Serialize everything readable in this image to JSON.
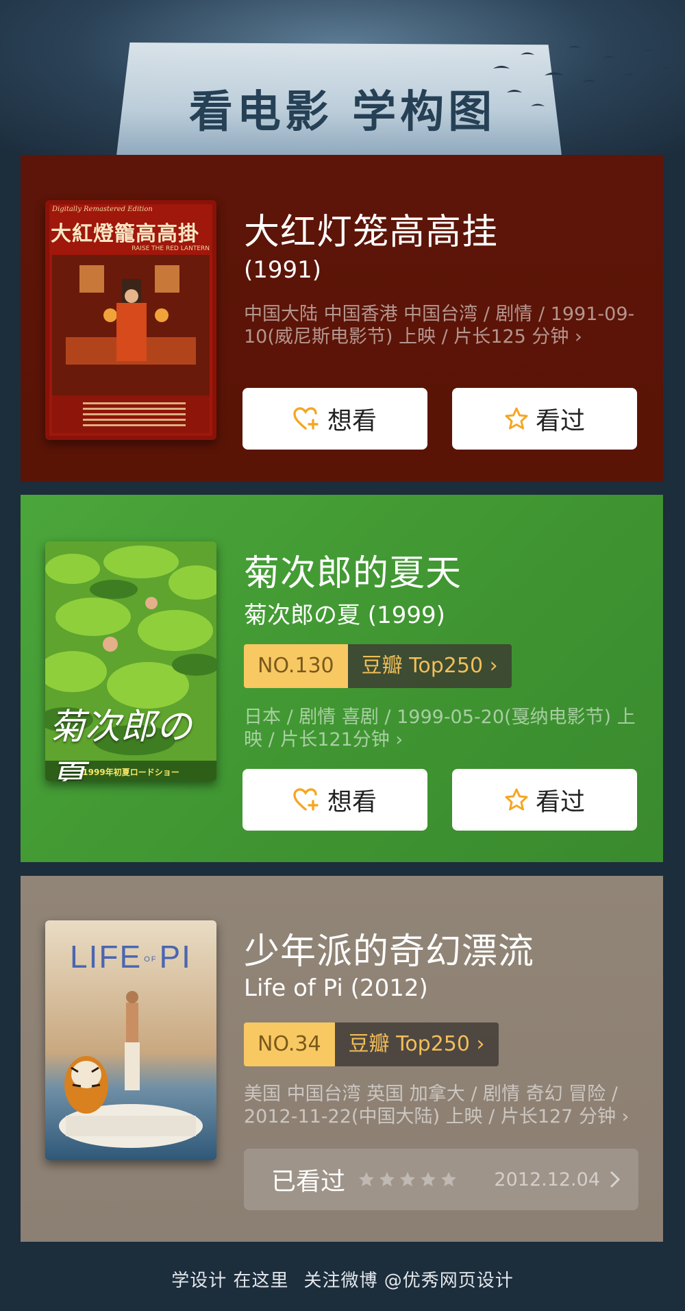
{
  "header": {
    "title": "看电影 学构图"
  },
  "movies": [
    {
      "title": "大红灯笼高高挂",
      "subtitle": "(1991)",
      "meta": "中国大陆 中国香港 中国台湾 / 剧情 / 1991-09-10(威尼斯电影节) 上映 / 片长125 分钟 ›",
      "poster": {
        "top_text": "Digitally Remastered Edition",
        "title_text": "大紅燈籠高高掛",
        "english": "RAISE THE RED LANTERN"
      },
      "want_label": "想看",
      "seen_label": "看过"
    },
    {
      "title": "菊次郎的夏天",
      "subtitle": "菊次郎の夏 (1999)",
      "rank": {
        "no": "NO.130",
        "link": "豆瓣 Top250 ›"
      },
      "meta": "日本 / 剧情 喜剧 / 1999-05-20(戛纳电影节) 上映 / 片长121分钟 ›",
      "poster": {
        "title_text": "菊次郎の夏",
        "footer_text": "1999年初夏ロードショー"
      },
      "want_label": "想看",
      "seen_label": "看过"
    },
    {
      "title": "少年派的奇幻漂流",
      "subtitle": "Life of Pi (2012)",
      "rank": {
        "no": "NO.34",
        "link": "豆瓣 Top250 ›"
      },
      "meta": "美国 中国台湾 英国 加拿大 / 剧情 奇幻 冒险 / 2012-11-22(中国大陆) 上映 / 片长127 分钟 ›",
      "poster": {
        "title_text": "LIFE",
        "of_text": "OF",
        "pi_text": "PI"
      },
      "watched": {
        "label": "已看过",
        "date": "2012.12.04",
        "rating": 0,
        "max": 5
      }
    }
  ],
  "footer": {
    "left": "学设计 在这里",
    "right": "关注微博 @优秀网页设计"
  },
  "colors": {
    "card1": "#5c1508",
    "card2": "#45a035",
    "card3": "#8f8376",
    "accent": "#f5a623",
    "rank_bg": "#f8c863"
  },
  "icons": {
    "want": "heart-plus-icon",
    "seen": "star-icon",
    "chevron": "chevron-right-icon"
  }
}
